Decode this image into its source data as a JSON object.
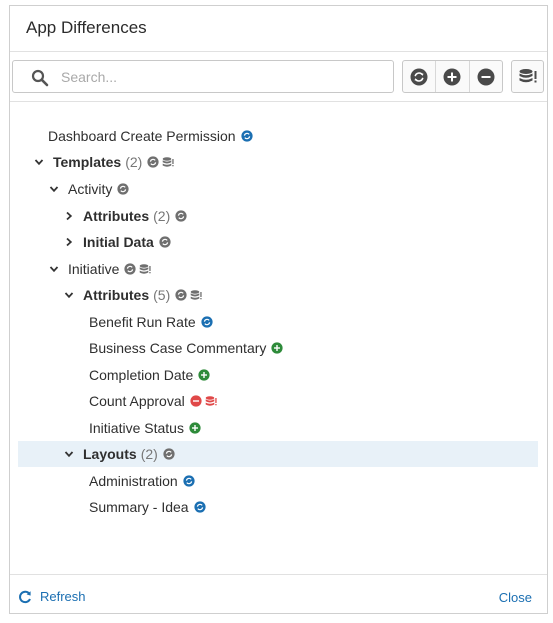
{
  "dialog": {
    "title": "App Differences"
  },
  "search": {
    "placeholder": "Search..."
  },
  "toolbar": {
    "icons": [
      "modified-filter-icon",
      "added-filter-icon",
      "removed-filter-icon",
      "data-filter-icon"
    ]
  },
  "tree": {
    "rows": [
      {
        "label": "Dashboard Create Permission",
        "count": "",
        "bold": false,
        "expand": "none",
        "icons": [
          "modified-blue"
        ]
      },
      {
        "label": "Templates",
        "count": "(2)",
        "bold": true,
        "expand": "open",
        "icons": [
          "modified-gray",
          "data-gray"
        ]
      },
      {
        "label": "Activity",
        "count": "",
        "bold": false,
        "expand": "open",
        "icons": [
          "modified-gray"
        ]
      },
      {
        "label": "Attributes",
        "count": "(2)",
        "bold": true,
        "expand": "closed",
        "icons": [
          "modified-gray"
        ]
      },
      {
        "label": "Initial Data",
        "count": "",
        "bold": true,
        "expand": "closed",
        "icons": [
          "modified-gray"
        ]
      },
      {
        "label": "Initiative",
        "count": "",
        "bold": false,
        "expand": "open",
        "icons": [
          "modified-gray",
          "data-gray"
        ]
      },
      {
        "label": "Attributes",
        "count": "(5)",
        "bold": true,
        "expand": "open",
        "icons": [
          "modified-gray",
          "data-gray"
        ]
      },
      {
        "label": "Benefit Run Rate",
        "count": "",
        "bold": false,
        "expand": "none",
        "icons": [
          "modified-blue"
        ]
      },
      {
        "label": "Business Case Commentary",
        "count": "",
        "bold": false,
        "expand": "none",
        "icons": [
          "added-green"
        ]
      },
      {
        "label": "Completion Date",
        "count": "",
        "bold": false,
        "expand": "none",
        "icons": [
          "added-green"
        ]
      },
      {
        "label": "Count Approval",
        "count": "",
        "bold": false,
        "expand": "none",
        "icons": [
          "removed-red",
          "data-red"
        ]
      },
      {
        "label": "Initiative Status",
        "count": "",
        "bold": false,
        "expand": "none",
        "icons": [
          "added-green"
        ]
      },
      {
        "label": "Layouts",
        "count": "(2)",
        "bold": true,
        "expand": "open",
        "icons": [
          "modified-gray"
        ],
        "selected": true
      },
      {
        "label": "Administration",
        "count": "",
        "bold": false,
        "expand": "none",
        "icons": [
          "modified-blue"
        ]
      },
      {
        "label": "Summary - Idea",
        "count": "",
        "bold": false,
        "expand": "none",
        "icons": [
          "modified-blue"
        ]
      }
    ]
  },
  "footer": {
    "refresh_label": "Refresh",
    "close_label": "Close"
  },
  "colors": {
    "blue": "#1b6fb2",
    "gray": "#6f6f6f",
    "green": "#2e8b3a",
    "red": "#e04848",
    "selected_row": "#e8f1f8"
  }
}
